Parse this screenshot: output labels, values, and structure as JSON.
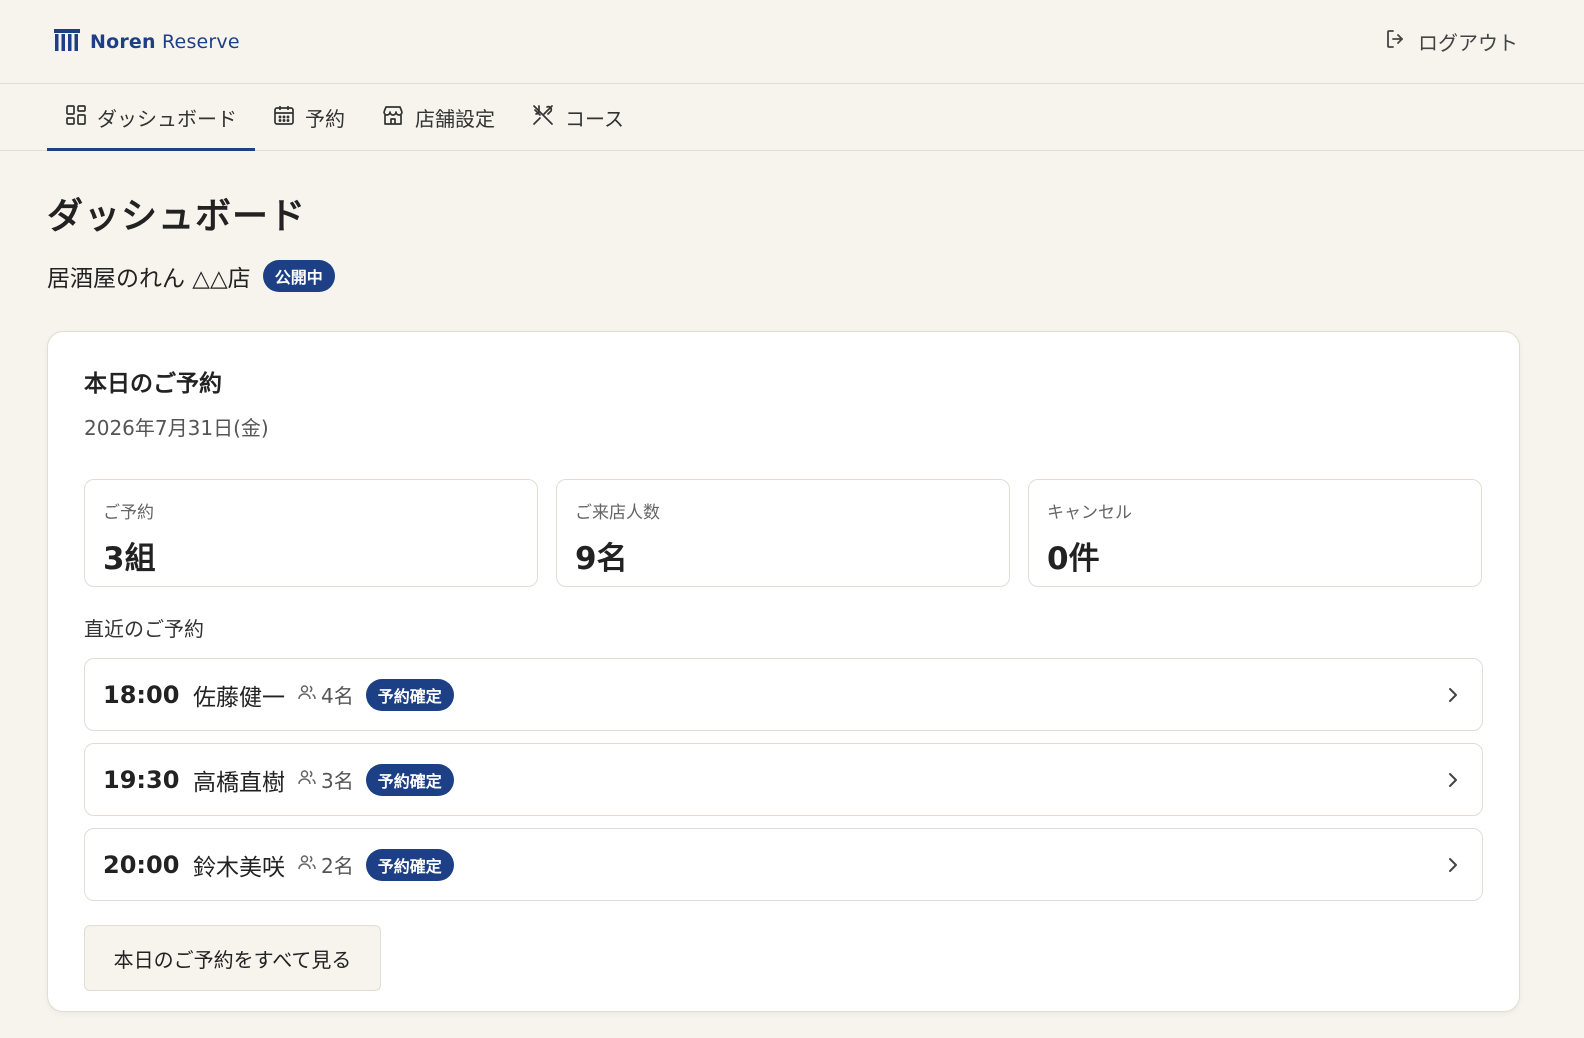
{
  "header": {
    "brand_name_bold": "Noren",
    "brand_name_light": "Reserve",
    "logout_label": "ログアウト"
  },
  "nav": {
    "tabs": [
      {
        "label": "ダッシュボード",
        "icon": "dashboard-grid-icon",
        "active": true
      },
      {
        "label": "予約",
        "icon": "calendar-icon",
        "active": false
      },
      {
        "label": "店舗設定",
        "icon": "store-icon",
        "active": false
      },
      {
        "label": "コース",
        "icon": "utensils-crossed-icon",
        "active": false
      }
    ]
  },
  "page": {
    "title": "ダッシュボード",
    "store_name": "居酒屋のれん △△店",
    "store_status": "公開中"
  },
  "today": {
    "title": "本日のご予約",
    "date": "2026年7月31日(金)",
    "stats": [
      {
        "label": "ご予約",
        "value": "3組"
      },
      {
        "label": "ご来店人数",
        "value": "9名"
      },
      {
        "label": "キャンセル",
        "value": "0件"
      }
    ],
    "recent_label": "直近のご予約",
    "reservations": [
      {
        "time": "18:00",
        "name": "佐藤健一",
        "guests": "4名",
        "status": "予約確定"
      },
      {
        "time": "19:30",
        "name": "高橋直樹",
        "guests": "3名",
        "status": "予約確定"
      },
      {
        "time": "20:00",
        "name": "鈴木美咲",
        "guests": "2名",
        "status": "予約確定"
      }
    ],
    "view_all_label": "本日のご予約をすべて見る"
  },
  "colors": {
    "accent": "#1d3f86",
    "background": "#f7f4ee",
    "card": "#ffffff",
    "border": "#e2ddd3"
  }
}
